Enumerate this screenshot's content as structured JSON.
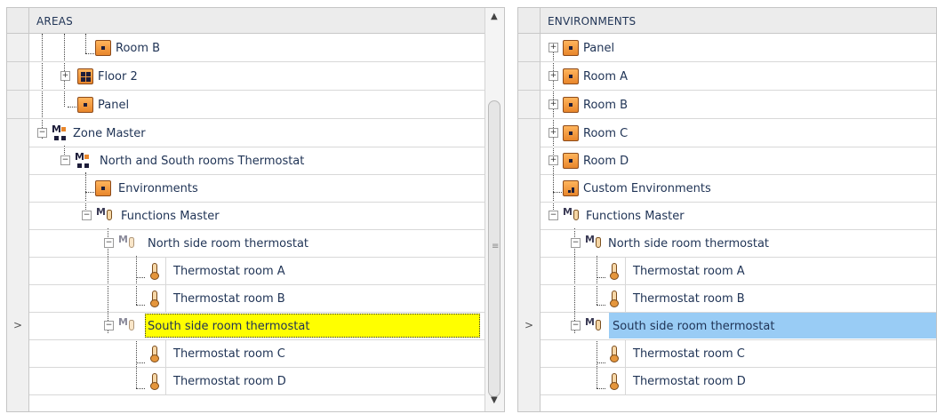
{
  "areas_panel": {
    "header": "AREAS",
    "rows": [
      {
        "label": "Room B"
      },
      {
        "label": "Floor 2"
      },
      {
        "label": "Panel"
      },
      {
        "label": "Zone Master"
      },
      {
        "label": "North and South rooms Thermostat"
      },
      {
        "label": "Environments"
      },
      {
        "label": "Functions Master"
      },
      {
        "label": "North side room thermostat"
      },
      {
        "label": "Thermostat room A"
      },
      {
        "label": "Thermostat room B"
      },
      {
        "label": "South side room thermostat"
      },
      {
        "label": "Thermostat room C"
      },
      {
        "label": "Thermostat room D"
      }
    ]
  },
  "environments_panel": {
    "header": "ENVIRONMENTS",
    "rows": [
      {
        "label": "Panel"
      },
      {
        "label": "Room A"
      },
      {
        "label": "Room B"
      },
      {
        "label": "Room C"
      },
      {
        "label": "Room D"
      },
      {
        "label": "Custom Environments"
      },
      {
        "label": "Functions Master"
      },
      {
        "label": "North side room thermostat"
      },
      {
        "label": "Thermostat room A"
      },
      {
        "label": "Thermostat room B"
      },
      {
        "label": "South side room thermostat"
      },
      {
        "label": "Thermostat room C"
      },
      {
        "label": "Thermostat room D"
      }
    ]
  },
  "colors": {
    "selection_yellow": "#ffff00",
    "selection_blue": "#99ccf5",
    "icon_orange": "#e8862b",
    "text": "#1f3355"
  }
}
